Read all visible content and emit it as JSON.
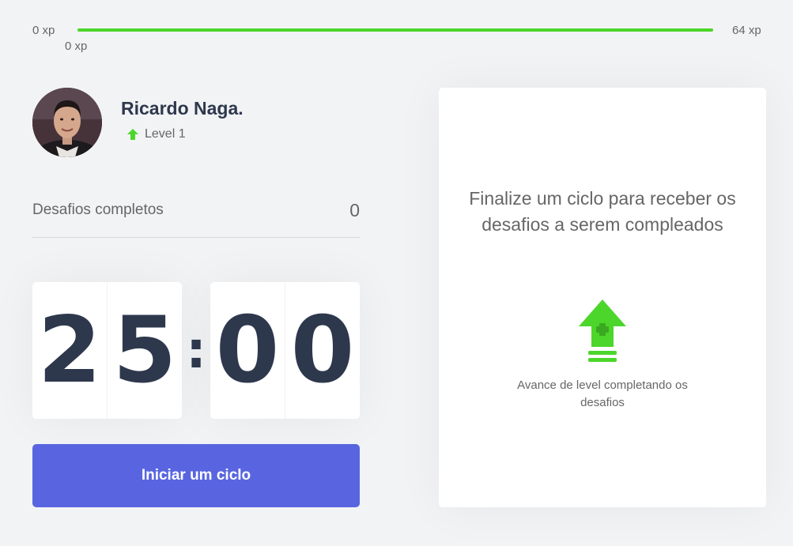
{
  "xp": {
    "min_label": "0 xp",
    "max_label": "64 xp",
    "current_label": "0 xp",
    "progress_fraction": 1.0
  },
  "profile": {
    "name": "Ricardo Naga.",
    "level_label": "Level 1"
  },
  "completed_challenges": {
    "label": "Desafios completos",
    "count": "0"
  },
  "countdown": {
    "minutes_tens": "2",
    "minutes_ones": "5",
    "separator": ":",
    "seconds_tens": "0",
    "seconds_ones": "0"
  },
  "start_button": {
    "label": "Iniciar um ciclo"
  },
  "challenge_panel": {
    "title": "Finalize um ciclo para receber os desafios a serem compleados",
    "hint": "Avance de level completando os desafios",
    "icon": "level-up-icon"
  },
  "colors": {
    "accent_green": "#4cd62b",
    "button_blue": "#5965e0",
    "title_dark": "#2e384d",
    "text_gray": "#666666",
    "background": "#f2f3f5"
  }
}
